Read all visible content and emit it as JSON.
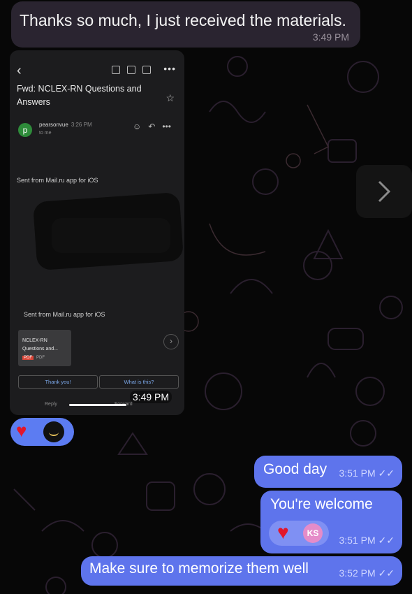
{
  "chat": {
    "incoming": {
      "text": "Thanks so much, I just received the materials.",
      "time": "3:49 PM"
    },
    "attachment": {
      "time": "3:49 PM",
      "email": {
        "subject": "Fwd: NCLEX-RN Questions and Answers",
        "sender_initial": "p",
        "sender": "pearsonvue",
        "sender_time": "3:26 PM",
        "to": "to me",
        "sent_from_1": "Sent from Mail.ru app for iOS",
        "sent_from_2": "Sent from Mail.ru app for iOS",
        "pdf_name": "NCLEX-RN Questions and...",
        "pdf_badge": "PDF",
        "pdf_type": "PDF",
        "quick_reply_1": "Thank you!",
        "quick_reply_2": "What is this?",
        "bottom_reply": "Reply",
        "bottom_forward": "Forward"
      }
    },
    "reactions": {
      "heart": "♥"
    },
    "outgoing": [
      {
        "text": "Good day",
        "time": "3:51 PM"
      },
      {
        "text": "You're welcome",
        "time": "3:51 PM",
        "reaction_initials": "KS"
      },
      {
        "text": "Make sure to memorize them well",
        "time": "3:52 PM"
      }
    ],
    "colors": {
      "background": "#070707",
      "outgoing_bubble": "#5e74ec",
      "incoming_bubble": "#2a2430",
      "heart": "#e2162b"
    },
    "icons": [
      "back-arrow-icon",
      "archive-icon",
      "trash-icon",
      "mail-icon",
      "more-icon",
      "star-icon",
      "emoji-icon",
      "reply-icon",
      "chevron-right-icon",
      "double-check-icon"
    ]
  }
}
